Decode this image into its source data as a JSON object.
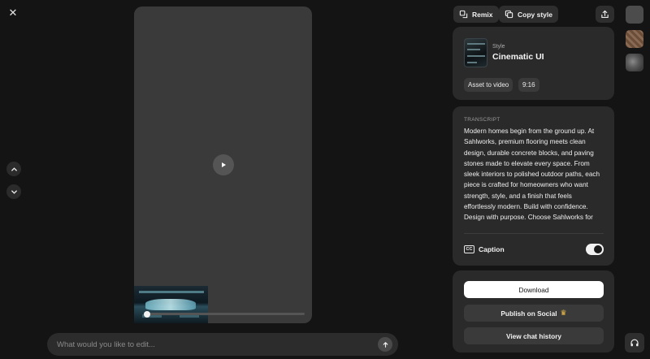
{
  "player": {
    "close_icon": "close-icon",
    "play_icon": "play-icon",
    "prev_icon": "chevron-up-icon",
    "next_icon": "chevron-down-icon",
    "progress": 0.02
  },
  "edit_bar": {
    "placeholder": "What would you like to edit...",
    "send_icon": "arrow-up-icon"
  },
  "toolbar": {
    "remix_label": "Remix",
    "copy_style_label": "Copy style",
    "share_icon": "share-upload-icon"
  },
  "style": {
    "label": "Style",
    "name": "Cinematic UI",
    "chips": [
      "Asset to video",
      "9:16"
    ]
  },
  "transcript": {
    "heading": "TRANSCRIPT",
    "text": "Modern homes begin from the ground up. At Sahlworks, premium flooring meets clean design, durable concrete blocks, and paving stones made to elevate every space. From sleek interiors to polished outdoor paths, each piece is crafted for homeowners who want strength, style, and a finish that feels effortlessly modern. Build with confidence. Design with purpose. Choose Sahlworks for flooring, blocks, and paving stones that bring"
  },
  "caption": {
    "icon_text": "CC",
    "label": "Caption",
    "enabled": true
  },
  "actions": {
    "download_label": "Download",
    "publish_label": "Publish on Social",
    "publish_badge": "♛",
    "history_label": "View chat history"
  },
  "colors": {
    "background": "#141414",
    "panel": "#2a2a2a",
    "button": "#3a3a3a",
    "crown": "#f2c14a"
  }
}
